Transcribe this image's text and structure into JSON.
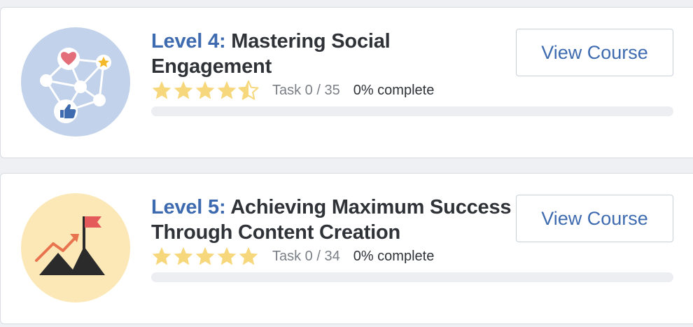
{
  "colors": {
    "accent": "#3e6bb0",
    "star": "#f7d77c",
    "thumb_1_bg": "#c2d2ea",
    "thumb_2_bg": "#fbe8b6"
  },
  "courses": [
    {
      "level_label": "Level 4:",
      "title": "Mastering Social Engagement",
      "rating": 4.5,
      "task_text": "Task 0 / 35",
      "complete_text": "0% complete",
      "progress": 0,
      "button_label": "View Course",
      "icon": "social-network-icon"
    },
    {
      "level_label": "Level 5:",
      "title": "Achieving Maximum Success Through Content Creation",
      "rating": 5,
      "task_text": "Task 0 / 34",
      "complete_text": "0% complete",
      "progress": 0,
      "button_label": "View Course",
      "icon": "mountain-flag-icon"
    }
  ]
}
